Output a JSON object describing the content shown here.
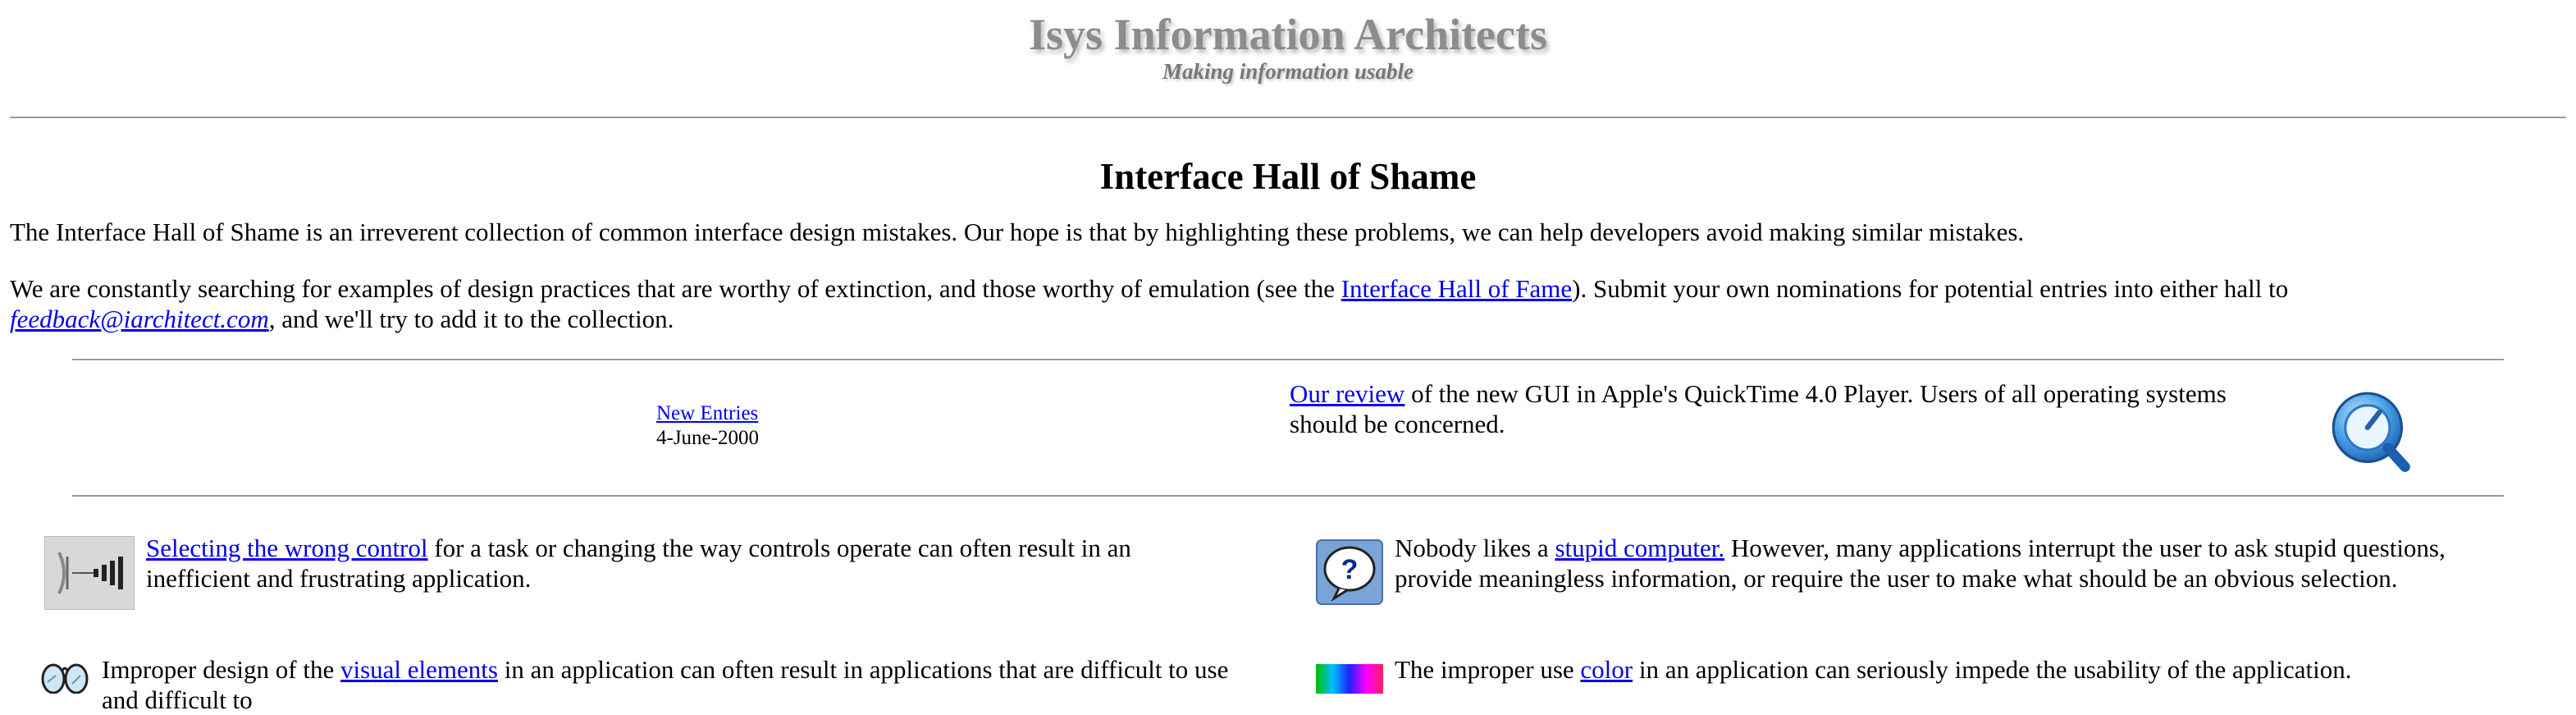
{
  "header": {
    "title": "Isys Information Architects",
    "tagline": "Making information usable"
  },
  "page_title": "Interface Hall of Shame",
  "intro": {
    "p1": "The Interface Hall of Shame is an irreverent collection of common interface design mistakes. Our hope is that by highlighting these problems, we can help developers avoid making similar mistakes.",
    "p2_a": "We are constantly searching for examples of design practices that are worthy of extinction, and those worthy of emulation (see the ",
    "p2_link": "Interface Hall of Fame",
    "p2_b": "). Submit your own nominations for potential entries into either hall to",
    "p2_email": "feedback@iarchitect.com",
    "p2_c": ", and we'll try to add it to the collection."
  },
  "news": {
    "link": "New Entries",
    "date": "4-June-2000",
    "review_link": "Our review",
    "review_text": " of the new GUI in Apple's QuickTime 4.0 Player. Users of all operating systems should be concerned."
  },
  "entries": {
    "controls_link": "Selecting the wrong control",
    "controls_text": " for a task or changing the way controls operate can often result in an inefficient and frustrating application.",
    "stupid_a": "Nobody likes a ",
    "stupid_link": "stupid computer.",
    "stupid_b": " However, many applications interrupt the user to ask stupid questions, provide meaningless information, or require the user to make what should be an obvious selection.",
    "visual_a": "Improper design of the ",
    "visual_link": "visual elements",
    "visual_b": " in an application can often result in applications that are difficult to use and difficult to",
    "color_a": "The improper use ",
    "color_link": "color",
    "color_b": " in an application can seriously impede the usability of the application."
  }
}
